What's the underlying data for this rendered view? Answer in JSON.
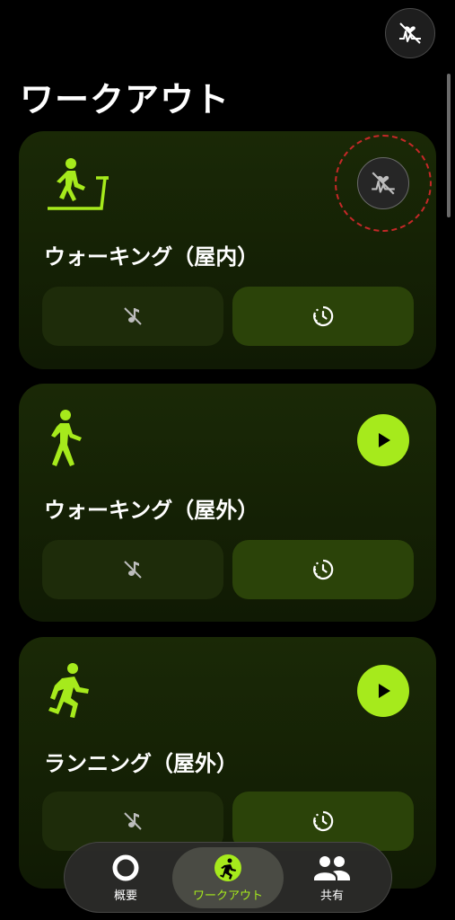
{
  "header": {
    "title": "ワークアウト",
    "hr_toggle_icon": "heart-rate-off-icon"
  },
  "accent_color": "#a6ea1c",
  "workouts": [
    {
      "title": "ウォーキング（屋内）",
      "icon": "treadmill-walking-icon",
      "action_icon": "heart-rate-off-icon"
    },
    {
      "title": "ウォーキング（屋外）",
      "icon": "walking-icon",
      "action_icon": "play-icon"
    },
    {
      "title": "ランニング（屋外）",
      "icon": "running-icon",
      "action_icon": "play-icon"
    }
  ],
  "tiles": {
    "left_icon": "music-off-icon",
    "right_icon": "timer-icon"
  },
  "bottom_nav": [
    {
      "label": "概要",
      "icon": "ring-icon",
      "active": false
    },
    {
      "label": "ワークアウト",
      "icon": "workout-runner-icon",
      "active": true
    },
    {
      "label": "共有",
      "icon": "people-icon",
      "active": false
    }
  ]
}
